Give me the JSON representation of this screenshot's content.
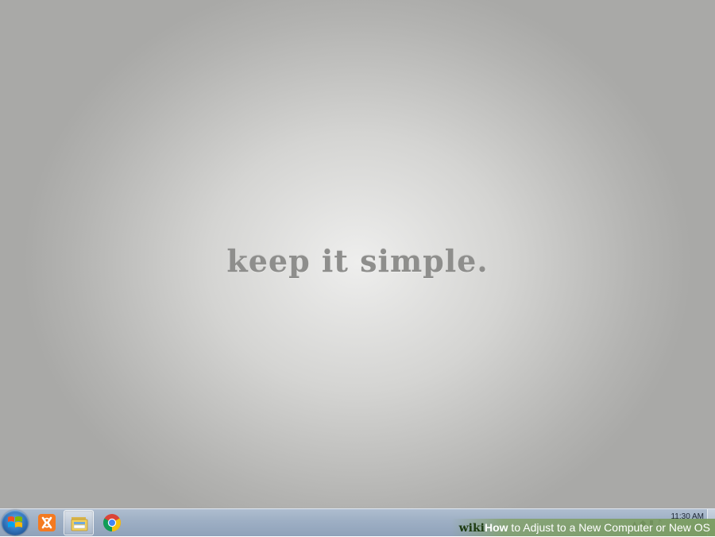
{
  "desktop": {
    "wallpaper_text": "keep it simple."
  },
  "taskbar": {
    "start_icon": "windows-logo-icon",
    "pinned": [
      {
        "name": "xampp",
        "icon": "xampp-icon",
        "active": false
      },
      {
        "name": "windows-explorer",
        "icon": "folder-icon",
        "active": true
      },
      {
        "name": "google-chrome",
        "icon": "chrome-icon",
        "active": false
      }
    ],
    "tray": {
      "clock_time": "11:30 AM",
      "tray_icons": "▴ ◆ ▮ ♪"
    }
  },
  "watermark": {
    "logo": "wiki",
    "how": "How",
    "text": " to Adjust to a New Computer or New OS"
  },
  "colors": {
    "taskbar": "#9fb0c5",
    "wallpaper_text": "#8e8e8c",
    "watermark_bg": "#789b5a"
  }
}
